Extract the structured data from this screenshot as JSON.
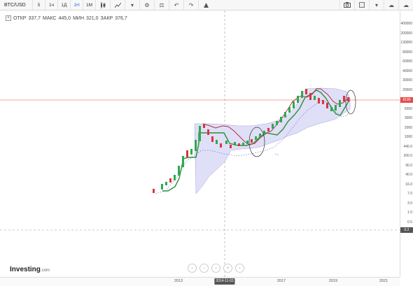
{
  "toolbar": {
    "symbol": "BTC/USD",
    "intervals": [
      {
        "label": "5",
        "active": false
      },
      {
        "label": "1ч",
        "active": false
      },
      {
        "label": "1Д",
        "active": false
      },
      {
        "label": "1Н",
        "active": true
      },
      {
        "label": "1М",
        "active": false
      }
    ],
    "icons": [
      "candles-icon",
      "area-chart-icon",
      "dropdown-icon",
      "settings-icon",
      "balance-icon",
      "undo-icon",
      "redo-icon",
      "alert-icon"
    ],
    "right_icons": [
      "camera-icon",
      "color-square-icon",
      "dropdown-icon",
      "cloud-save-icon",
      "cloud-load-icon"
    ]
  },
  "ohlc": {
    "open_label": "ОТКР",
    "open": "337,7",
    "high_label": "МАКС",
    "high": "445,0",
    "low_label": "МИН",
    "low": "321,0",
    "close_label": "ЗАКР",
    "close": "376,7"
  },
  "y_ticks": [
    "400000",
    "200000",
    "130000",
    "80000",
    "60000",
    "40000",
    "30000",
    "20000",
    "12000",
    "6000",
    "3000",
    "2000",
    "1000",
    "440.0",
    "200.0",
    "90.0",
    "40.0",
    "16.0",
    "7.0",
    "3.0",
    "1.0",
    "0.5",
    "0.2"
  ],
  "current_price_tag": "8190",
  "bottom_tag": "0.2",
  "x_ticks": [
    "2013",
    "2015",
    "2017",
    "2019",
    "2021"
  ],
  "cursor_date": "2014-11-03",
  "logo": {
    "brand": "Investing",
    "suffix": ".com"
  },
  "nav_buttons": [
    "‹",
    "−",
    "○",
    "+",
    "›"
  ],
  "colors": {
    "up": "#2fa84f",
    "down": "#d9363e",
    "cloud": "#dcdcf7",
    "cloud_edge": "#9a9ad8",
    "green_line": "#2f8f3a",
    "red_line": "#b0304a",
    "price_line": "#e84a4a"
  }
}
